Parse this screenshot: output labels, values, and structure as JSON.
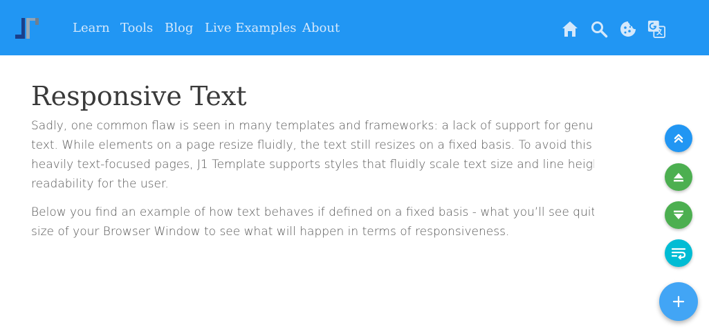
{
  "colors": {
    "navbar": "#2196f3",
    "nav_text": "#d4e8fb",
    "fab_blue": "#2196f3",
    "fab_green": "#4caf50",
    "fab_cyan": "#00bcd4",
    "fab_main": "#42a5f5"
  },
  "nav": {
    "logo_icon": "j1-logo",
    "links": [
      "Learn",
      "Tools",
      "Blog",
      "Live Examples",
      "About"
    ],
    "icons": [
      "home-icon",
      "search-icon",
      "cookie-icon",
      "translate-icon"
    ]
  },
  "main": {
    "title": "Responsive Text",
    "paragraph1_lines": [
      "Sadly, one common flaw is seen in many templates and frameworks: a lack of support for genuinely",
      "text. While elements on a page resize fluidly, the text still resizes on a fixed basis. To avoid this issue,",
      "heavily text-focused pages, J1 Template supports styles that fluidly scale text size and line height to",
      "readability for the user."
    ],
    "paragraph2_lines": [
      "Below you find an example of how text behaves if defined on a fixed basis - what you’ll see quite ofte",
      "size of your Browser Window to see what will happen in terms of responsiveness."
    ]
  },
  "fabs": {
    "icons": [
      "double-chevron-up-icon",
      "eject-up-icon",
      "eject-down-icon",
      "wrap-text-icon",
      "plus-icon"
    ]
  }
}
